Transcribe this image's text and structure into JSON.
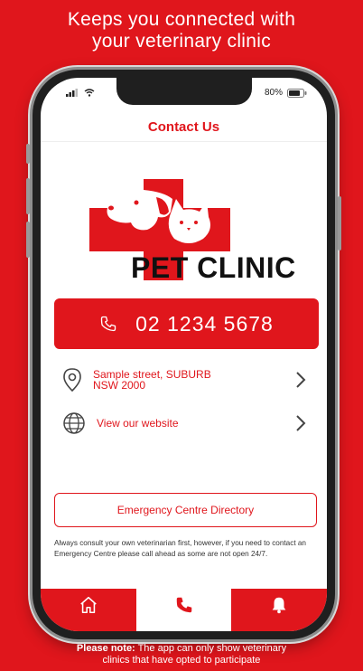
{
  "promo": {
    "headline_line1": "Keeps you connected with",
    "headline_line2": "your veterinary clinic",
    "note_bold": "Please note:",
    "note_rest": " The app can only show veterinary",
    "note_line2": "clinics that have opted to participate"
  },
  "status_bar": {
    "battery_percent": "80%",
    "battery_level": 0.8
  },
  "screen": {
    "title": "Contact Us"
  },
  "logo": {
    "text": "PET CLINIC"
  },
  "contact": {
    "phone": "02 1234 5678",
    "address_line1": "Sample street, SUBURB",
    "address_line2": "NSW 2000",
    "website_label": "View our website"
  },
  "emergency": {
    "button_label": "Emergency Centre Directory",
    "disclaimer": "Always consult your own veterinarian first, however, if you need to contact an Emergency Centre please call ahead as some are not open 24/7."
  },
  "tabs": [
    {
      "icon": "home-icon",
      "active": false
    },
    {
      "icon": "phone-icon",
      "active": true
    },
    {
      "icon": "bell-icon",
      "active": false
    }
  ],
  "colors": {
    "brand_red": "#e0161c",
    "text_dark": "#111111"
  }
}
